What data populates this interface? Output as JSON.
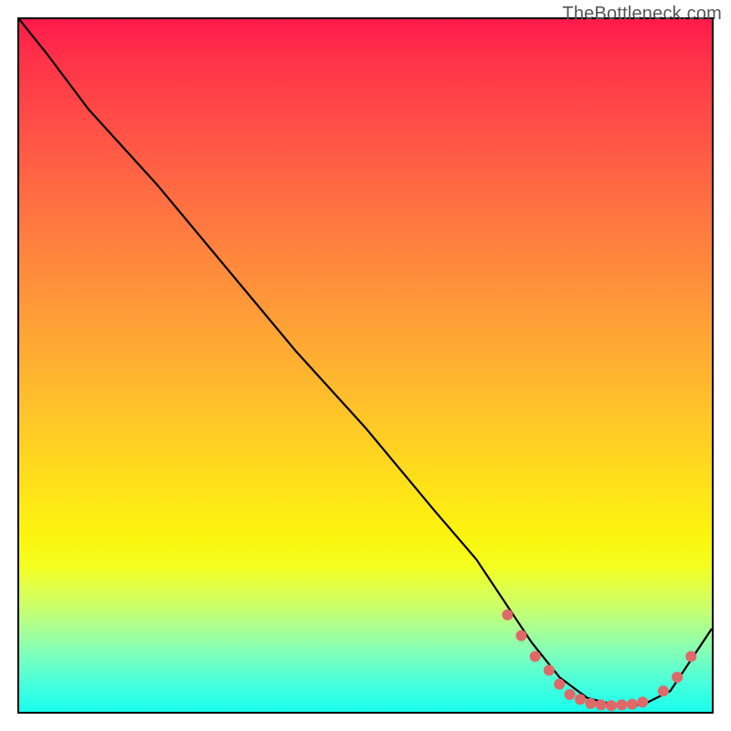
{
  "watermark": "TheBottleneck.com",
  "chart_data": {
    "type": "line",
    "title": "",
    "xlabel": "",
    "ylabel": "",
    "xlim": [
      0,
      100
    ],
    "ylim": [
      0,
      100
    ],
    "grid": false,
    "legend": false,
    "series": [
      {
        "name": "bottleneck-curve",
        "x": [
          0,
          4,
          10,
          20,
          30,
          40,
          50,
          60,
          66,
          70,
          74,
          78,
          82,
          86,
          90,
          94,
          100
        ],
        "y": [
          100,
          95,
          87,
          76,
          64,
          52,
          41,
          29,
          22,
          16,
          10,
          5,
          2,
          1,
          1,
          3,
          12
        ],
        "color": "#000000"
      }
    ],
    "markers": [
      {
        "name": "trough-point",
        "x": 70.5,
        "y": 14,
        "color": "#e06868"
      },
      {
        "name": "trough-point",
        "x": 72.5,
        "y": 11,
        "color": "#e06868"
      },
      {
        "name": "trough-point",
        "x": 74.5,
        "y": 8,
        "color": "#e06868"
      },
      {
        "name": "trough-point",
        "x": 76.5,
        "y": 6,
        "color": "#e06868"
      },
      {
        "name": "trough-point",
        "x": 78.0,
        "y": 4,
        "color": "#e06868"
      },
      {
        "name": "trough-point",
        "x": 79.5,
        "y": 2.5,
        "color": "#e06868"
      },
      {
        "name": "trough-point",
        "x": 81.0,
        "y": 1.8,
        "color": "#e06868"
      },
      {
        "name": "trough-point",
        "x": 82.5,
        "y": 1.2,
        "color": "#e06868"
      },
      {
        "name": "trough-point",
        "x": 84.0,
        "y": 1.0,
        "color": "#e06868"
      },
      {
        "name": "trough-point",
        "x": 85.5,
        "y": 0.9,
        "color": "#e06868"
      },
      {
        "name": "trough-point",
        "x": 87.0,
        "y": 1.0,
        "color": "#e06868"
      },
      {
        "name": "trough-point",
        "x": 88.5,
        "y": 1.1,
        "color": "#e06868"
      },
      {
        "name": "trough-point",
        "x": 90.0,
        "y": 1.4,
        "color": "#e06868"
      },
      {
        "name": "trough-point",
        "x": 93.0,
        "y": 3.0,
        "color": "#e06868"
      },
      {
        "name": "trough-point",
        "x": 95.0,
        "y": 5.0,
        "color": "#e06868"
      },
      {
        "name": "trough-point",
        "x": 97.0,
        "y": 8.0,
        "color": "#e06868"
      }
    ],
    "gradient_stops": [
      {
        "offset": 0,
        "color": "#ff1a4a"
      },
      {
        "offset": 6,
        "color": "#ff3349"
      },
      {
        "offset": 18,
        "color": "#ff5746"
      },
      {
        "offset": 30,
        "color": "#ff7a40"
      },
      {
        "offset": 42,
        "color": "#ff9b38"
      },
      {
        "offset": 55,
        "color": "#ffbf2c"
      },
      {
        "offset": 67,
        "color": "#ffe01a"
      },
      {
        "offset": 75,
        "color": "#fbf60e"
      },
      {
        "offset": 79,
        "color": "#f3ff1f"
      },
      {
        "offset": 82,
        "color": "#e0ff4a"
      },
      {
        "offset": 85,
        "color": "#c9ff6d"
      },
      {
        "offset": 88,
        "color": "#aaff93"
      },
      {
        "offset": 91,
        "color": "#86ffb4"
      },
      {
        "offset": 94,
        "color": "#5fffcf"
      },
      {
        "offset": 97,
        "color": "#3bffe1"
      },
      {
        "offset": 100,
        "color": "#18ffed"
      }
    ]
  }
}
